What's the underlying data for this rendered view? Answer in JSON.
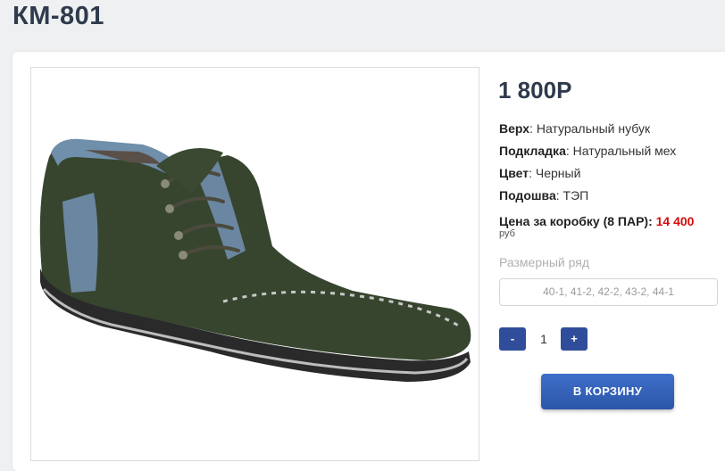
{
  "product": {
    "title": "КМ-801",
    "price": "1 800Р",
    "image_alt": "shoe-photo"
  },
  "specs": [
    {
      "label": "Верх",
      "value": ": Натуральный нубук"
    },
    {
      "label": "Подкладка",
      "value": ": Натуральный мех"
    },
    {
      "label": "Цвет",
      "value": ": Черный"
    },
    {
      "label": "Подошва",
      "value": ": ТЭП"
    }
  ],
  "box_price": {
    "label": "Цена за коробку (8 ПАР):",
    "value": "14 400",
    "currency": "руб"
  },
  "sizes": {
    "label": "Размерный ряд",
    "value": "40-1, 41-2, 42-2, 43-2, 44-1"
  },
  "quantity": {
    "minus": "-",
    "value": "1",
    "plus": "+"
  },
  "cart": {
    "button_label": "В КОРЗИНУ"
  },
  "colors": {
    "accent": "#2f4d9a",
    "price_red": "#d60a0a",
    "title": "#2f3b4c"
  }
}
